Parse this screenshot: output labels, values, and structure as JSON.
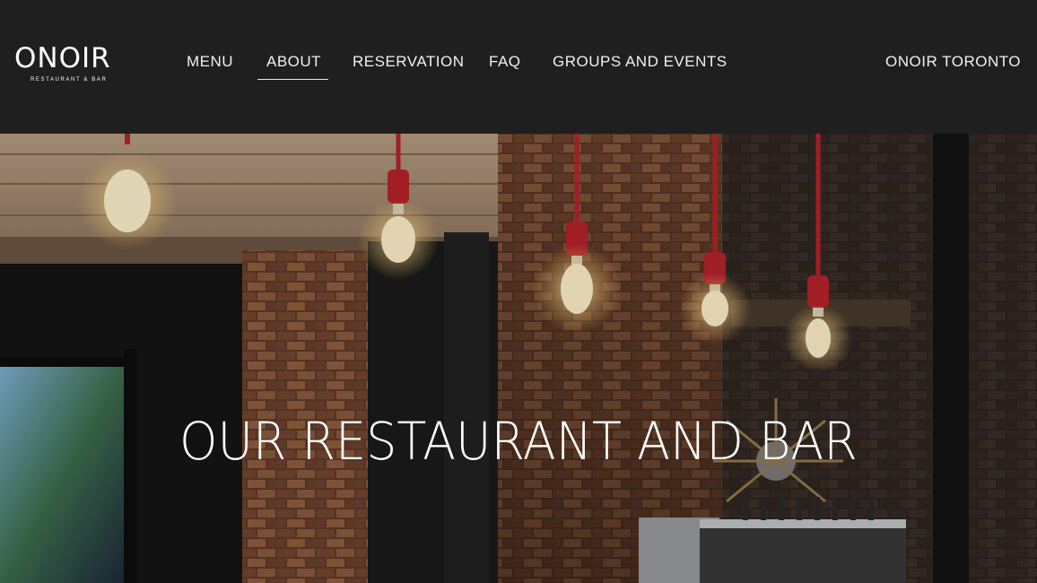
{
  "brand": {
    "logo_text": "ONOIR",
    "tagline": "RESTAURANT & BAR"
  },
  "nav": {
    "items": [
      "MENU",
      "ABOUT",
      "RESERVATION",
      "FAQ",
      "GROUPS AND EVENTS"
    ],
    "active": "ABOUT",
    "location": "ONOIR TORONTO"
  },
  "hero": {
    "title": "OUR RESTAURANT AND BAR"
  },
  "colors": {
    "header_bg": "#1f1f20",
    "nav_text": "#f1f1f1",
    "cord_red": "#b8232a",
    "bulb_glow": "#ffe7a8"
  }
}
